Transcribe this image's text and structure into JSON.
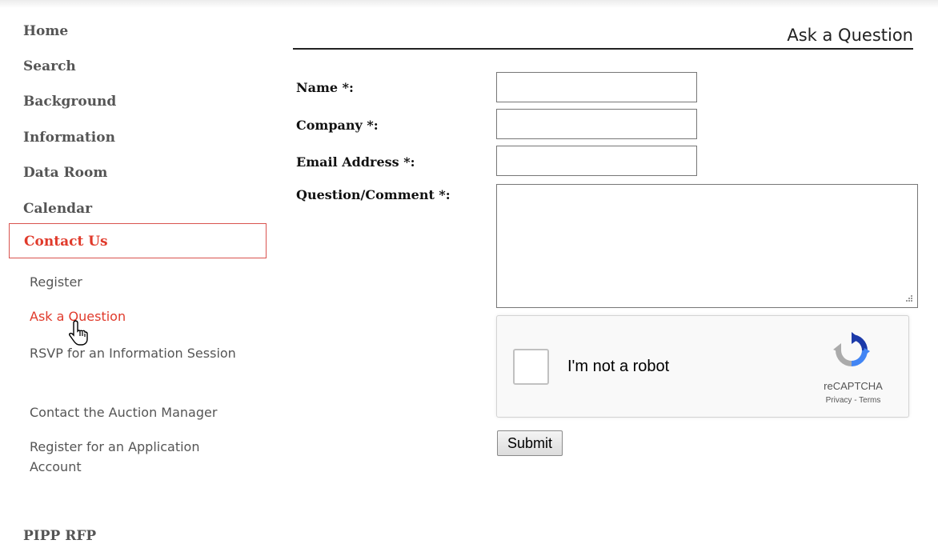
{
  "sidebar": {
    "nav": [
      {
        "label": "Home"
      },
      {
        "label": "Search"
      },
      {
        "label": "Background"
      },
      {
        "label": "Information"
      },
      {
        "label": "Data Room"
      },
      {
        "label": "Calendar"
      }
    ],
    "active": {
      "label": "Contact Us"
    },
    "sub_items": [
      {
        "label": "Register"
      },
      {
        "label": "Ask a Question"
      },
      {
        "label": "RSVP for an Information Session"
      },
      {
        "label": "Contact the Auction Manager"
      },
      {
        "label": "Register for an Application Account"
      }
    ],
    "bottom": {
      "label": "PIPP RFP"
    }
  },
  "main": {
    "title": "Ask a Question",
    "form": {
      "name_label": "Name *:",
      "name_value": "",
      "company_label": "Company *:",
      "company_value": "",
      "email_label": "Email Address *:",
      "email_value": "",
      "question_label": "Question/Comment *:",
      "question_value": ""
    },
    "captcha": {
      "label": "I'm not a robot",
      "brand": "reCAPTCHA",
      "privacy": "Privacy",
      "separator": " - ",
      "terms": "Terms"
    },
    "submit_label": "Submit"
  },
  "colors": {
    "accent": "#e03a2b",
    "nav_text": "#555555"
  }
}
